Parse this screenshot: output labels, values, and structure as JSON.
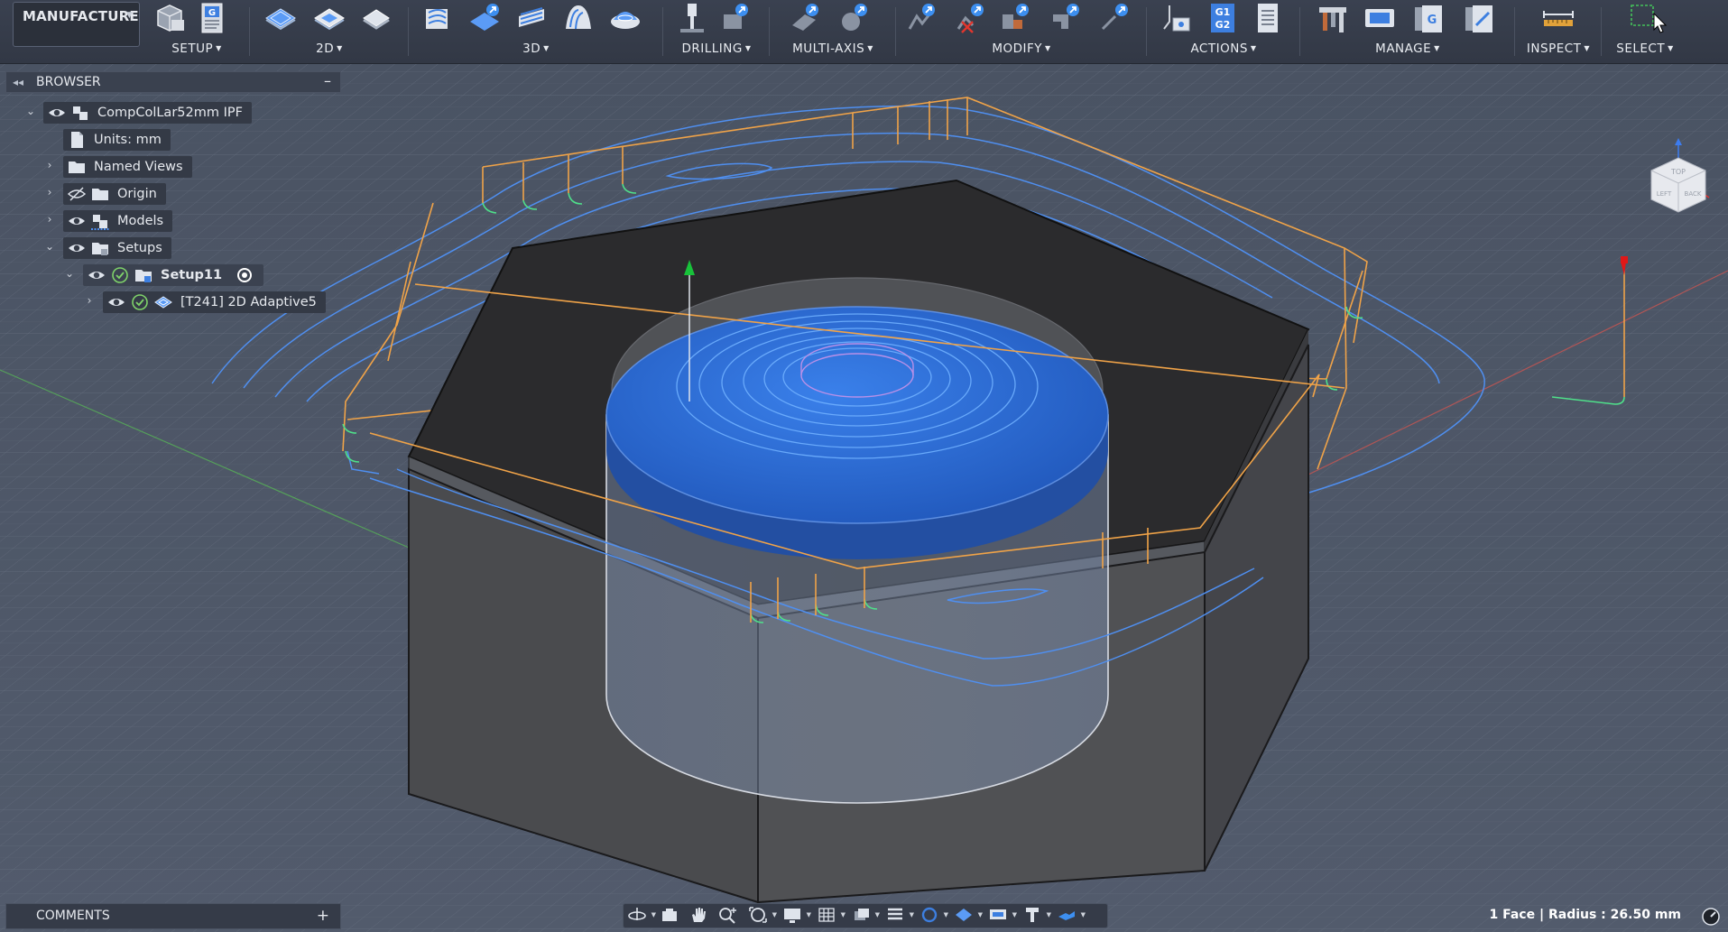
{
  "workspace": {
    "label": "MANUFACTURE"
  },
  "ribbon": {
    "groups": [
      {
        "id": "setup",
        "label": "SETUP"
      },
      {
        "id": "2d",
        "label": "2D"
      },
      {
        "id": "3d",
        "label": "3D"
      },
      {
        "id": "drilling",
        "label": "DRILLING"
      },
      {
        "id": "multiaxis",
        "label": "MULTI-AXIS"
      },
      {
        "id": "modify",
        "label": "MODIFY"
      },
      {
        "id": "actions",
        "label": "ACTIONS"
      },
      {
        "id": "manage",
        "label": "MANAGE"
      },
      {
        "id": "inspect",
        "label": "INSPECT"
      },
      {
        "id": "select",
        "label": "SELECT"
      }
    ],
    "icon_glyphs": {
      "g_code": "G",
      "g1g2_top": "G1",
      "g1g2_bottom": "G2"
    }
  },
  "browser": {
    "title": "BROWSER",
    "items": [
      {
        "label": "CompColLar52mm IPF",
        "icon": "component-icon"
      },
      {
        "label": "Units: mm",
        "icon": "document-icon"
      },
      {
        "label": "Named Views",
        "icon": "folder-icon"
      },
      {
        "label": "Origin",
        "icon": "folder-icon"
      },
      {
        "label": "Models",
        "icon": "models-icon"
      },
      {
        "label": "Setups",
        "icon": "setups-icon"
      },
      {
        "label": "Setup11",
        "icon": "setup-icon"
      },
      {
        "label": "[T241] 2D Adaptive5",
        "icon": "adaptive-operation-icon"
      }
    ]
  },
  "comments": {
    "title": "COMMENTS"
  },
  "status": {
    "selection": "1 Face | Radius : 26.50 mm"
  },
  "viewcube": {
    "faces": [
      "TOP",
      "BACK",
      "LEFT"
    ]
  },
  "colors": {
    "viewport_bg": "#4c5566",
    "part_top": "#2b2b2d",
    "part_side": "#4a4b4e",
    "cylinder_top": "#2e6ed9",
    "toolpath_cut": "#4f8ff0",
    "toolpath_lead": "#f0a348",
    "toolpath_ramp": "#4fe08a",
    "axis_green": "#18c23a",
    "axis_red": "#e01818"
  }
}
